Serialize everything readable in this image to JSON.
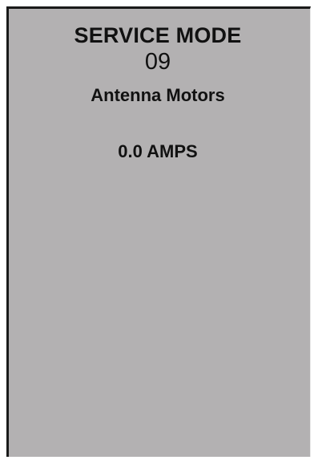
{
  "screen": {
    "title": "SERVICE MODE",
    "mode_number": "09",
    "mode_name": "Antenna Motors",
    "reading": "0.0 AMPS"
  },
  "colors": {
    "background": "#b3b1b2",
    "text": "#111111",
    "border": "#1a1a1a"
  }
}
